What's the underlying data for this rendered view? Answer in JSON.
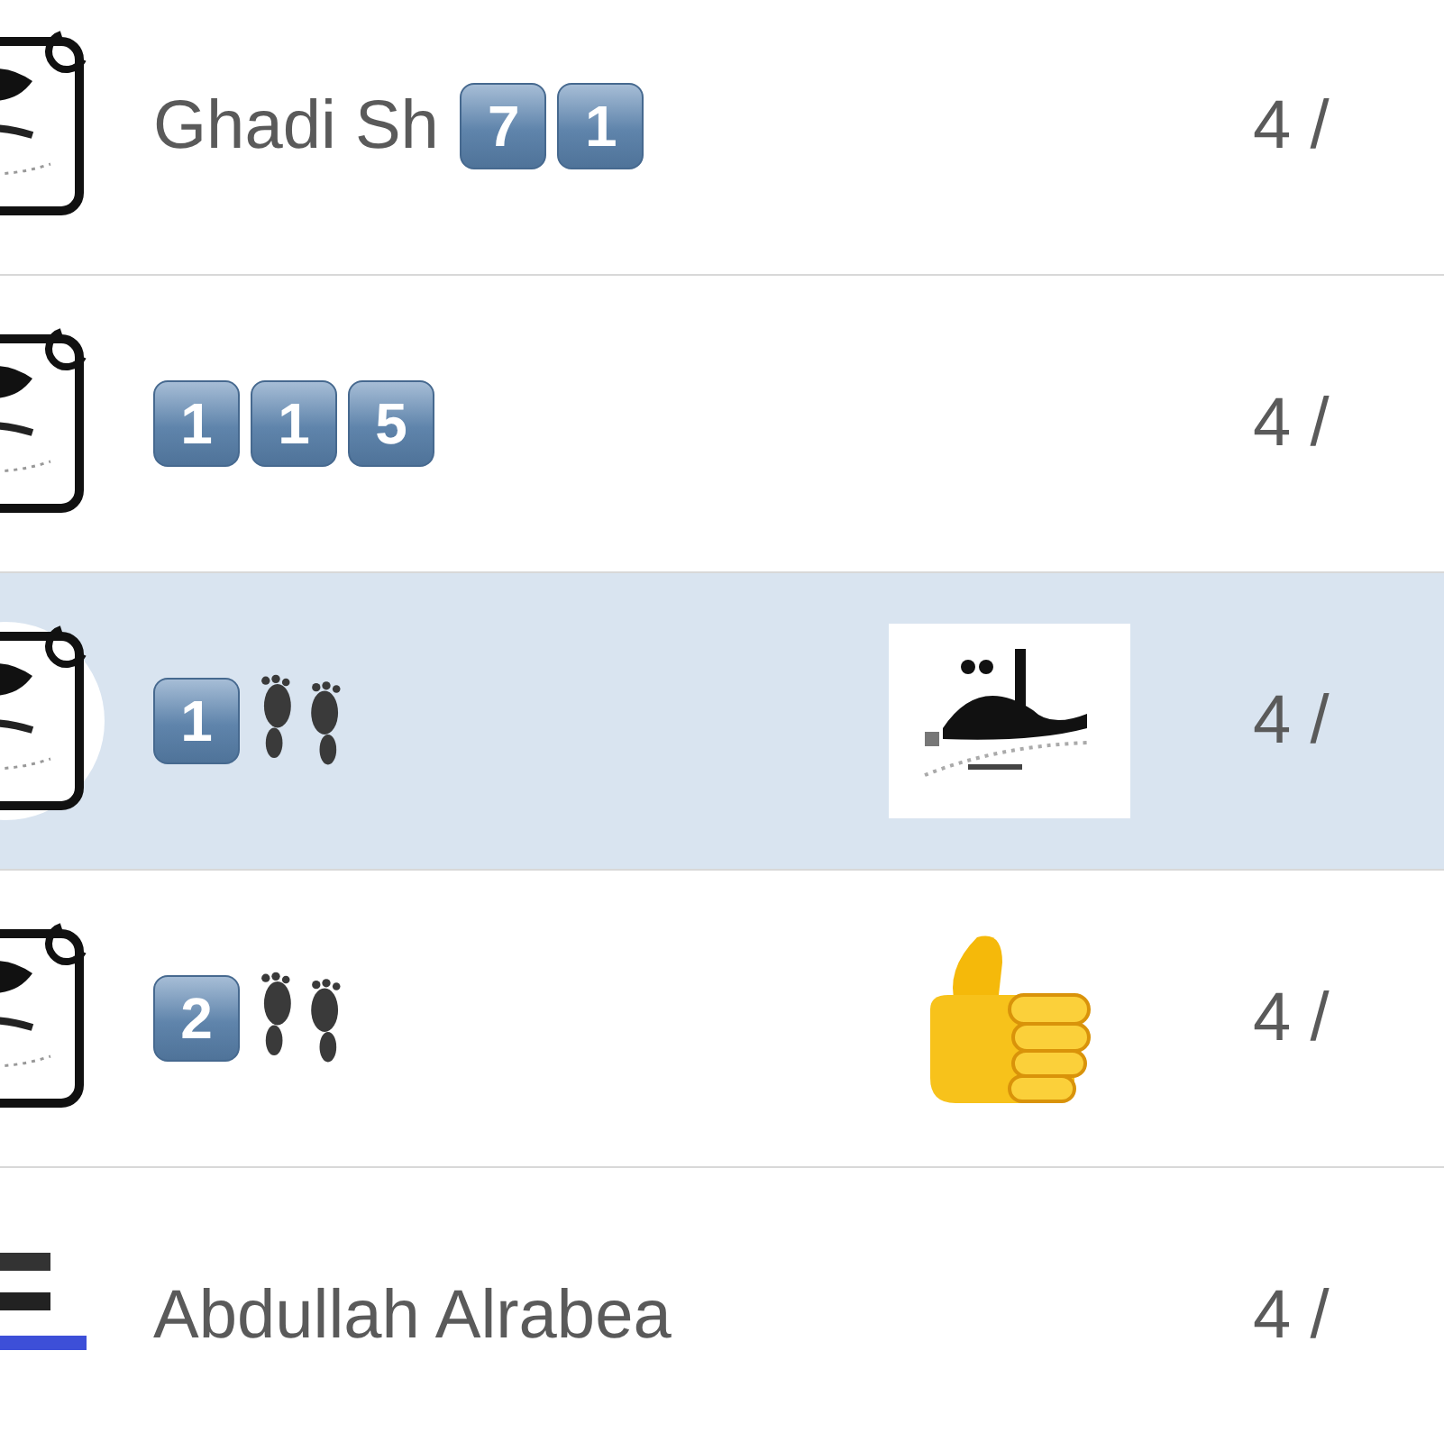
{
  "chats": [
    {
      "avatar": {
        "kind": "picture"
      },
      "name_parts": [
        {
          "kind": "text",
          "text": "Ghadi Sh"
        },
        {
          "kind": "keycap",
          "text": "7"
        },
        {
          "kind": "keycap",
          "text": "1"
        }
      ],
      "selected": false,
      "time": "4 /"
    },
    {
      "avatar": {
        "kind": "picture"
      },
      "name_parts": [
        {
          "kind": "keycap",
          "text": "1"
        },
        {
          "kind": "keycap",
          "text": "1"
        },
        {
          "kind": "keycap",
          "text": "5"
        }
      ],
      "selected": false,
      "time": "4 /"
    },
    {
      "avatar": {
        "kind": "picture"
      },
      "name_parts": [
        {
          "kind": "keycap",
          "text": "1"
        },
        {
          "kind": "footprints"
        }
      ],
      "attachment": {
        "kind": "picture"
      },
      "selected": true,
      "time": "4 /"
    },
    {
      "avatar": {
        "kind": "picture"
      },
      "name_parts": [
        {
          "kind": "keycap",
          "text": "2"
        },
        {
          "kind": "footprints"
        }
      ],
      "attachment": {
        "kind": "thumbs_up"
      },
      "selected": false,
      "time": "4 /"
    },
    {
      "avatar": {
        "kind": "picture"
      },
      "name_parts": [
        {
          "kind": "text",
          "text": "Abdullah Alrabea"
        }
      ],
      "selected": false,
      "time": "4 /"
    }
  ]
}
